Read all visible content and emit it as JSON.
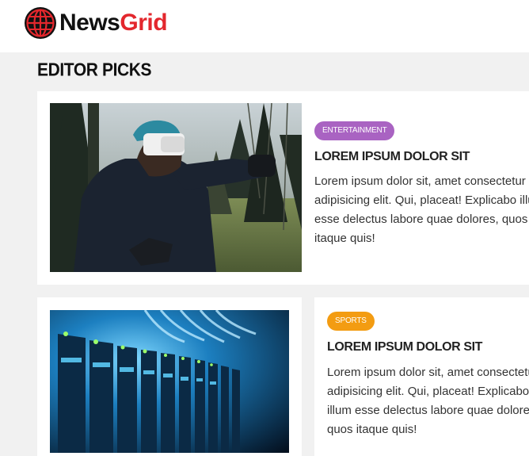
{
  "brand": {
    "name_part1": "News",
    "name_part2": "Grid",
    "colors": {
      "dark": "#111111",
      "accent": "#e3272d"
    },
    "logo_icon": "globe-icon"
  },
  "section": {
    "title": "EDITOR PICKS"
  },
  "posts": [
    {
      "category": "ENTERTAINMENT",
      "category_color": "#a963c2",
      "title": "LOREM IPSUM DOLOR SIT",
      "excerpt_lines": [
        "Lorem ipsum dolor sit, amet consectetur",
        "adipisicing elit. Qui, placeat! Explicabo illum",
        "esse delectus labore quae dolores, quos",
        "itaque quis!"
      ],
      "image": "vr-headset-man-in-forest"
    },
    {
      "category": "SPORTS",
      "category_color": "#f39c12",
      "title": "LOREM IPSUM DOLOR SIT",
      "excerpt_lines": [
        "Lorem ipsum dolor sit, amet consectetur",
        "adipisicing elit. Qui, placeat! Explicabo",
        "illum esse delectus labore quae dolores,",
        "quos itaque quis!"
      ],
      "image": "server-rack-blue-lights"
    }
  ]
}
